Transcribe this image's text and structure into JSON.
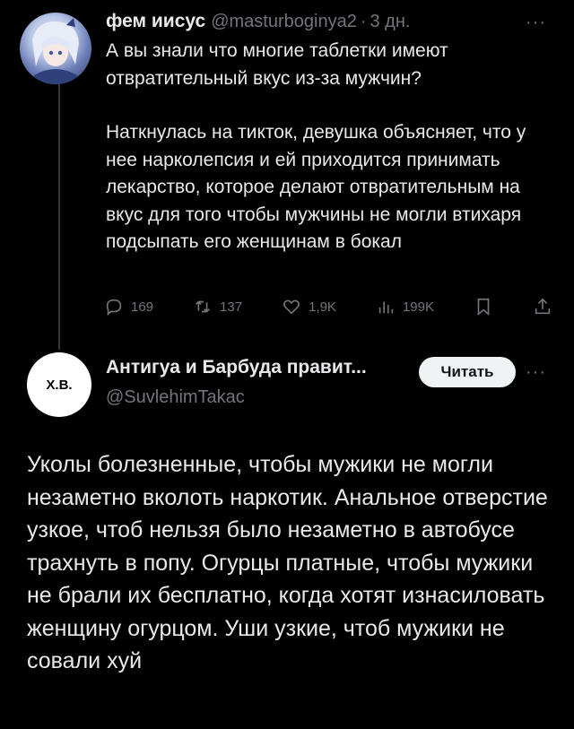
{
  "tweet1": {
    "name": "фем иисус",
    "handle": "@masturboginya2",
    "separator": "·",
    "time": "3 дн.",
    "paragraphs": [
      "А вы знали что многие таблетки имеют отвратительный вкус из-за мужчин?",
      "Наткнулась на тикток, девушка объясняет, что у нее нарколепсия и ей приходится принимать лекарство, которое делают отвратительным на вкус для того чтобы мужчины не могли втихаря подсыпать его женщинам в бокал"
    ],
    "more_icon": "···",
    "actions": {
      "replies": "169",
      "retweets": "137",
      "likes": "1,9K",
      "views": "199K"
    }
  },
  "tweet2": {
    "avatar_text": "Х.В.",
    "name": "Антигуа и Барбуда правит...",
    "handle": "@SuvlehimTakac",
    "follow_label": "Читать",
    "more_icon": "···",
    "text": "Уколы болезненные, чтобы мужики не могли незаметно вколоть наркотик. Анальное отверстие узкое, чтоб нельзя было незаметно в автобусе трахнуть в попу. Огурцы платные, чтобы мужики не брали их бесплатно, когда хотят изнасиловать женщину огурцом. Уши узкие, чтоб мужики не совали хуй"
  }
}
